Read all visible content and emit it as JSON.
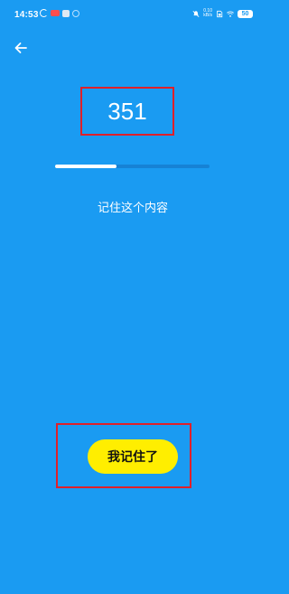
{
  "status_bar": {
    "time": "14:53",
    "net_speed_value": "0.10",
    "net_speed_unit": "kB/s",
    "battery": "50"
  },
  "main": {
    "number": "351",
    "progress": 0.4,
    "instruction": "记住这个内容",
    "remember_button_label": "我记住了"
  },
  "colors": {
    "background": "#1a9bf2",
    "button": "#ffee00",
    "highlight_box": "#e0202a"
  }
}
